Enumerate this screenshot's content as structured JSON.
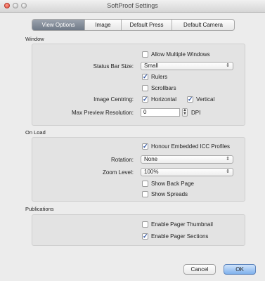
{
  "window": {
    "title": "SoftProof Settings"
  },
  "tabs": [
    "View Options",
    "Image",
    "Default Press",
    "Default Camera"
  ],
  "sections": {
    "window": {
      "label": "Window",
      "allow_multiple_windows": {
        "label": "Allow Multiple Windows",
        "checked": false
      },
      "status_bar_size": {
        "label": "Status Bar Size:",
        "value": "Small"
      },
      "rulers": {
        "label": "Rulers",
        "checked": true
      },
      "scrollbars": {
        "label": "Scrollbars",
        "checked": false
      },
      "image_centring": {
        "label": "Image Centring:",
        "horizontal": {
          "label": "Horizontal",
          "checked": true
        },
        "vertical": {
          "label": "Vertical",
          "checked": true
        }
      },
      "max_preview_resolution": {
        "label": "Max Preview Resolution:",
        "value": "0",
        "unit": "DPI"
      }
    },
    "on_load": {
      "label": "On Load",
      "honour_icc": {
        "label": "Honour Embedded ICC Profiles",
        "checked": true
      },
      "rotation": {
        "label": "Rotation:",
        "value": "None"
      },
      "zoom_level": {
        "label": "Zoom Level:",
        "value": "100%"
      },
      "show_back_page": {
        "label": "Show Back Page",
        "checked": false
      },
      "show_spreads": {
        "label": "Show Spreads",
        "checked": false
      }
    },
    "publications": {
      "label": "Publications",
      "enable_pager_thumbnail": {
        "label": "Enable Pager Thumbnail",
        "checked": false
      },
      "enable_pager_sections": {
        "label": "Enable Pager Sections",
        "checked": true
      }
    }
  },
  "buttons": {
    "cancel": "Cancel",
    "ok": "OK"
  },
  "glyphs": {
    "check": "✓",
    "updown": "⇕"
  }
}
